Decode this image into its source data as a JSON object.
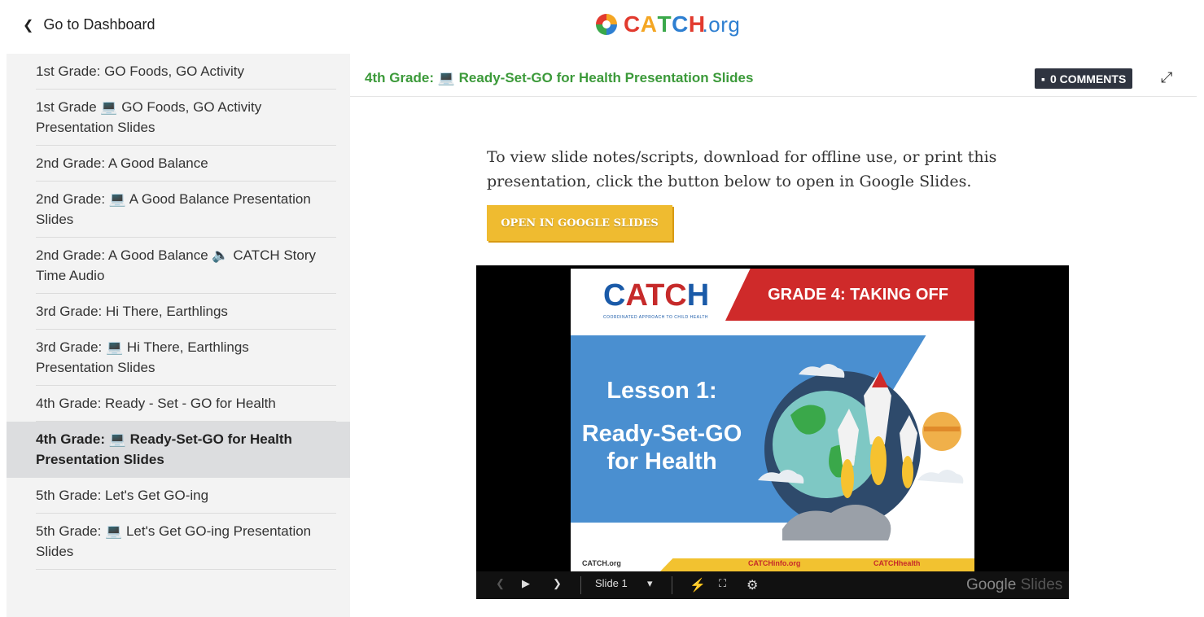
{
  "header": {
    "back_label": "Go to Dashboard",
    "logo_text": "CATCH",
    "logo_suffix": ".org"
  },
  "sidebar": {
    "items": [
      {
        "label": "1st Grade: GO Foods, GO Activity",
        "active": false
      },
      {
        "label": "1st Grade 💻 GO Foods, GO Activity Presentation Slides",
        "active": false
      },
      {
        "label": "2nd Grade: A Good Balance",
        "active": false
      },
      {
        "label": "2nd Grade: 💻 A Good Balance Presentation Slides",
        "active": false
      },
      {
        "label": "2nd Grade: A Good Balance 🔈 CATCH Story Time Audio",
        "active": false
      },
      {
        "label": "3rd Grade: Hi There, Earthlings",
        "active": false
      },
      {
        "label": "3rd Grade: 💻 Hi There, Earthlings Presentation Slides",
        "active": false
      },
      {
        "label": "4th Grade: Ready - Set - GO for Health",
        "active": false
      },
      {
        "label": "4th Grade: 💻 Ready-Set-GO for Health Presentation Slides",
        "active": true
      },
      {
        "label": "5th Grade: Let's Get GO-ing",
        "active": false
      },
      {
        "label": "5th Grade: 💻 Let's Get GO-ing Presentation Slides",
        "active": false
      }
    ]
  },
  "main": {
    "title": "4th Grade: 💻 Ready-Set-GO for Health Presentation Slides",
    "comments_label": "0 COMMENTS",
    "info_text": "To view slide notes/scripts, download for offline use, or print this presentation, click the button below to open in Google Slides.",
    "open_button_label": "OPEN IN GOOGLE SLIDES"
  },
  "slide": {
    "logo": "CATCH",
    "tagline": "COORDINATED APPROACH TO CHILD HEALTH",
    "banner": "GRADE 4: TAKING OFF",
    "lesson": "Lesson 1:",
    "lesson_title_1": "Ready-Set-GO",
    "lesson_title_2": "for Health",
    "footer_left": "CATCH.org",
    "footer_mid": "CATCHinfo.org",
    "footer_right": "CATCHhealth"
  },
  "player": {
    "slide_select": "Slide 1",
    "brand": "Google",
    "brand_suffix": "Slides"
  },
  "colors": {
    "title_green": "#3c9a3a",
    "button_yellow": "#efbb30",
    "badge_dark": "#2f3440",
    "active_row": "#dcdddf"
  }
}
